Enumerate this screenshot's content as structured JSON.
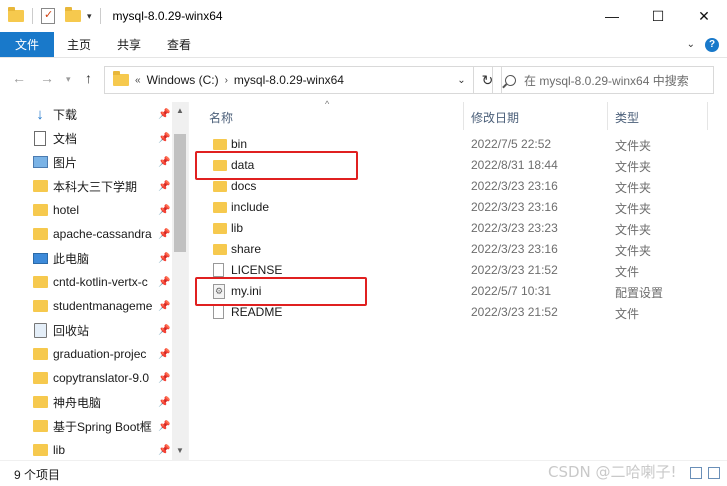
{
  "window": {
    "title": "mysql-8.0.29-winx64",
    "minimize": "—",
    "maximize": "☐",
    "close": "✕"
  },
  "ribbon": {
    "tabs": [
      "文件",
      "主页",
      "共享",
      "查看"
    ]
  },
  "address": {
    "prefix": "«",
    "crumbs": [
      "Windows (C:)",
      "mysql-8.0.29-winx64"
    ],
    "search_placeholder": "在 mysql-8.0.29-winx64 中搜索"
  },
  "sidebar": {
    "items": [
      {
        "label": "下载",
        "icon": "download-icon",
        "pinned": true
      },
      {
        "label": "文档",
        "icon": "document-icon",
        "pinned": true
      },
      {
        "label": "图片",
        "icon": "picture-icon",
        "pinned": true
      },
      {
        "label": "本科大三下学期",
        "icon": "folder-icon",
        "pinned": true
      },
      {
        "label": "hotel",
        "icon": "folder-icon",
        "pinned": true
      },
      {
        "label": "apache-cassandra",
        "icon": "folder-icon",
        "pinned": true
      },
      {
        "label": "此电脑",
        "icon": "computer-icon",
        "pinned": true
      },
      {
        "label": "cntd-kotlin-vertx-c",
        "icon": "folder-icon",
        "pinned": true
      },
      {
        "label": "studentmanageme",
        "icon": "folder-icon",
        "pinned": true
      },
      {
        "label": "回收站",
        "icon": "recycle-bin-icon",
        "pinned": true
      },
      {
        "label": "graduation-projec",
        "icon": "folder-icon",
        "pinned": true
      },
      {
        "label": "copytranslator-9.0",
        "icon": "folder-icon",
        "pinned": true
      },
      {
        "label": "神舟电脑",
        "icon": "folder-icon",
        "pinned": true
      },
      {
        "label": "基于Spring Boot框",
        "icon": "folder-icon",
        "pinned": true
      },
      {
        "label": "lib",
        "icon": "folder-icon",
        "pinned": true
      }
    ]
  },
  "columns": {
    "name": "名称",
    "date": "修改日期",
    "type": "类型"
  },
  "files": [
    {
      "name": "bin",
      "date": "2022/7/5 22:52",
      "type": "文件夹",
      "icon": "folder-icon"
    },
    {
      "name": "data",
      "date": "2022/8/31 18:44",
      "type": "文件夹",
      "icon": "folder-icon"
    },
    {
      "name": "docs",
      "date": "2022/3/23 23:16",
      "type": "文件夹",
      "icon": "folder-icon"
    },
    {
      "name": "include",
      "date": "2022/3/23 23:16",
      "type": "文件夹",
      "icon": "folder-icon"
    },
    {
      "name": "lib",
      "date": "2022/3/23 23:23",
      "type": "文件夹",
      "icon": "folder-icon"
    },
    {
      "name": "share",
      "date": "2022/3/23 23:16",
      "type": "文件夹",
      "icon": "folder-icon"
    },
    {
      "name": "LICENSE",
      "date": "2022/3/23 21:52",
      "type": "文件",
      "icon": "file-icon"
    },
    {
      "name": "my.ini",
      "date": "2022/5/7 10:31",
      "type": "配置设置",
      "icon": "settings-file-icon"
    },
    {
      "name": "README",
      "date": "2022/3/23 21:52",
      "type": "文件",
      "icon": "file-icon"
    }
  ],
  "status": {
    "count": "9 个项目"
  },
  "watermark": "CSDN @二哈喇子!"
}
